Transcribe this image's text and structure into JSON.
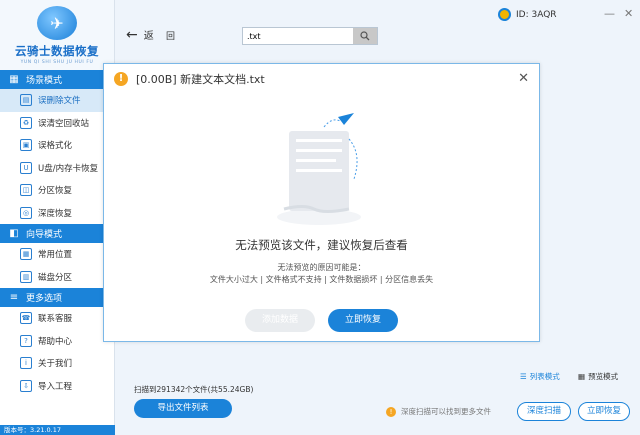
{
  "app": {
    "title": "云骑士数据恢复",
    "subtitle": "YUN QI SHI SHU JU HUI FU",
    "version": "版本号：3.21.0.17"
  },
  "sidebar": {
    "sections": [
      {
        "title": "场景模式",
        "icon": "grid-icon",
        "items": [
          {
            "label": "误删除文件",
            "active": true,
            "icon": "trash-icon"
          },
          {
            "label": "误清空回收站",
            "active": false,
            "icon": "recycle-bin-icon"
          },
          {
            "label": "误格式化",
            "active": false,
            "icon": "format-icon"
          },
          {
            "label": "U盘/内存卡恢复",
            "active": false,
            "icon": "usb-icon"
          },
          {
            "label": "分区恢复",
            "active": false,
            "icon": "partition-icon"
          },
          {
            "label": "深度恢复",
            "active": false,
            "icon": "deep-recovery-icon"
          }
        ]
      },
      {
        "title": "向导模式",
        "icon": "wizard-icon",
        "items": [
          {
            "label": "常用位置",
            "active": false,
            "icon": "location-icon"
          },
          {
            "label": "磁盘分区",
            "active": false,
            "icon": "disk-icon"
          }
        ]
      },
      {
        "title": "更多选项",
        "icon": "menu-icon",
        "items": [
          {
            "label": "联系客服",
            "active": false,
            "icon": "support-icon"
          },
          {
            "label": "帮助中心",
            "active": false,
            "icon": "help-icon"
          },
          {
            "label": "关于我们",
            "active": false,
            "icon": "info-icon"
          },
          {
            "label": "导入工程",
            "active": false,
            "icon": "import-icon"
          }
        ]
      }
    ]
  },
  "topbar": {
    "back_label": "返",
    "refresh_label": "回",
    "search_value": ".txt",
    "user_id": "ID: 3AQR",
    "minimize": "—",
    "close": "✕"
  },
  "dialog": {
    "title": "[0.00B] 新建文本文档.txt",
    "main_message": "无法预览该文件，建议恢复后查看",
    "sub_message": "无法预览的原因可能是：",
    "reasons": "文件大小过大 | 文件格式不支持 | 文件数据损坏 | 分区信息丢失",
    "disabled_button": "添加数据",
    "primary_button": "立即恢复"
  },
  "bottom": {
    "list_mode": "列表模式",
    "preview_mode": "预览模式",
    "scan_info": "扫描到291342个文件(共55.24GB)",
    "export_button": "导出文件列表",
    "tip": "深度扫描可以找到更多文件",
    "deep_scan_button": "深度扫描",
    "recover_button": "立即恢复"
  },
  "colors": {
    "accent": "#1b83d9",
    "warning": "#f5a623",
    "active_bg": "#d7e9f8"
  }
}
